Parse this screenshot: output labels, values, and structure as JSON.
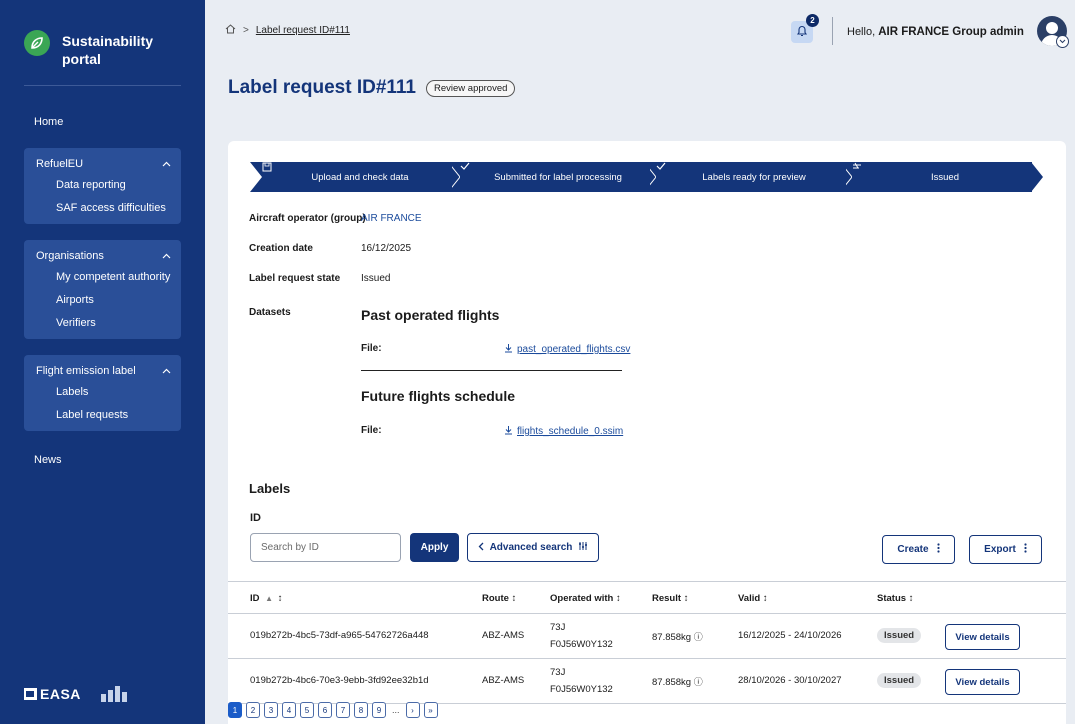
{
  "brand": {
    "title": "Sustainability portal"
  },
  "sidebar": {
    "home": "Home",
    "groups": [
      {
        "label": "RefuelEU",
        "items": [
          "Data reporting",
          "SAF access difficulties"
        ]
      },
      {
        "label": "Organisations",
        "items": [
          "My competent authority",
          "Airports",
          "Verifiers"
        ]
      },
      {
        "label": "Flight emission label",
        "items": [
          "Labels",
          "Label requests"
        ]
      }
    ],
    "news": "News",
    "footer_logo": "EASA"
  },
  "header": {
    "breadcrumb": "Label request ID#111",
    "notification_count": "2",
    "greeting": "Hello,",
    "user": "AIR FRANCE Group admin"
  },
  "page": {
    "title": "Label request ID#111",
    "status": "Review approved"
  },
  "stepper": {
    "steps": [
      "Upload and check data",
      "Submitted for label processing",
      "Labels ready for preview",
      "Issued"
    ]
  },
  "details": {
    "operator_label": "Aircraft operator (group)",
    "operator_value": "AIR FRANCE",
    "creation_label": "Creation date",
    "creation_value": "16/12/2025",
    "state_label": "Label request state",
    "state_value": "Issued",
    "datasets_label": "Datasets"
  },
  "datasets": [
    {
      "title": "Past operated flights",
      "file_label": "File:",
      "file": "past_operated_flights.csv"
    },
    {
      "title": "Future flights schedule",
      "file_label": "File:",
      "file": "flights_schedule_0.ssim"
    }
  ],
  "labels": {
    "title": "Labels",
    "id_label": "ID",
    "search_placeholder": "Search by ID",
    "apply": "Apply",
    "advanced": "Advanced search",
    "create": "Create",
    "export": "Export"
  },
  "table": {
    "columns": [
      "ID",
      "Route",
      "Operated with",
      "Result",
      "Valid",
      "Status"
    ],
    "rows": [
      {
        "id": "019b272b-4bc5-73df-a965-54762726a448",
        "route": "ABZ-AMS",
        "op1": "73J",
        "op2": "F0J56W0Y132",
        "result": "87.858kg",
        "valid": "16/12/2025 - 24/10/2026",
        "status": "Issued",
        "action": "View details"
      },
      {
        "id": "019b272b-4bc6-70e3-9ebb-3fd92ee32b1d",
        "route": "ABZ-AMS",
        "op1": "73J",
        "op2": "F0J56W0Y132",
        "result": "87.858kg",
        "valid": "28/10/2026 - 30/10/2027",
        "status": "Issued",
        "action": "View details"
      }
    ]
  },
  "pagination": {
    "pages": [
      "1",
      "2",
      "3",
      "4",
      "5",
      "6",
      "7",
      "8",
      "9"
    ],
    "ellipsis": "...",
    "next": "›",
    "last": "»",
    "current": "1"
  },
  "colors": {
    "primary": "#14357a",
    "accent": "#1b5cc8",
    "leaf": "#3aa655"
  }
}
